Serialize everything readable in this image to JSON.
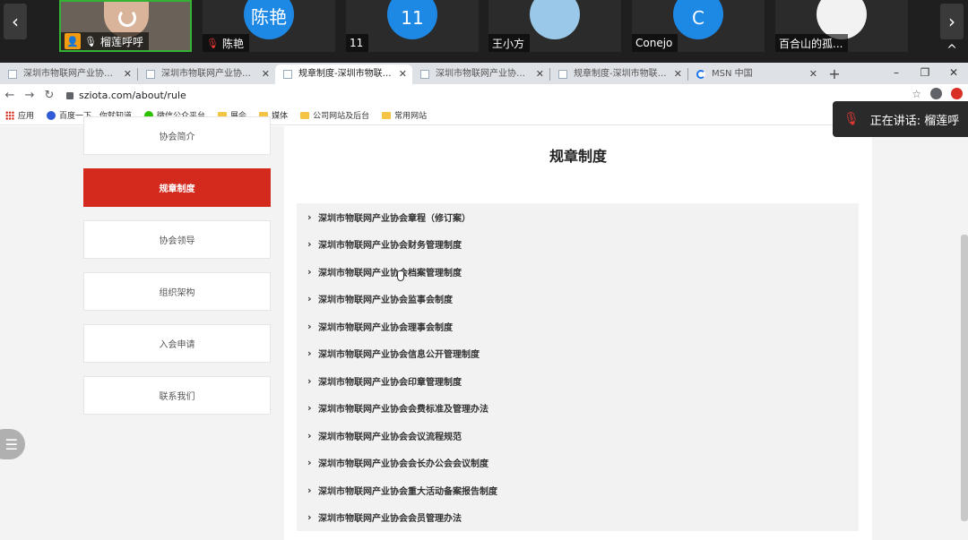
{
  "meeting": {
    "participants": [
      {
        "name": "榴莲呼呼",
        "avatar": ""
      },
      {
        "name": "陈艳",
        "avatar": "陈艳"
      },
      {
        "name": "11",
        "avatar": "11"
      },
      {
        "name": "王小方",
        "avatar": ""
      },
      {
        "name": "Conejo",
        "avatar": "C"
      },
      {
        "name": "百合山的孤...",
        "avatar": ""
      }
    ],
    "speaking": "正在讲话: 榴莲呼"
  },
  "browser": {
    "tabs": [
      {
        "title": "深圳市物联网产业协会-官方网站"
      },
      {
        "title": "深圳市物联网产业协会-官方网站"
      },
      {
        "title": "规章制度-深圳市物联网产业协会"
      },
      {
        "title": "深圳市物联网产业协会-官方网站"
      },
      {
        "title": "规章制度-深圳市物联网产业协会"
      },
      {
        "title": "MSN 中国"
      }
    ],
    "new_tab": "+",
    "url": "sziota.com/about/rule",
    "bookmarks": [
      "应用",
      "百度一下，你就知道",
      "微信公众平台",
      "展会",
      "媒体",
      "公司网站及后台",
      "常用网站"
    ]
  },
  "sidebar": {
    "items": [
      {
        "label": "协会简介"
      },
      {
        "label": "规章制度"
      },
      {
        "label": "协会领导"
      },
      {
        "label": "组织架构"
      },
      {
        "label": "入会申请"
      },
      {
        "label": "联系我们"
      }
    ]
  },
  "content": {
    "title": "规章制度",
    "rules": [
      "深圳市物联网产业协会章程（修订案）",
      "深圳市物联网产业协会财务管理制度",
      "深圳市物联网产业协会档案管理制度",
      "深圳市物联网产业协会监事会制度",
      "深圳市物联网产业协会理事会制度",
      "深圳市物联网产业协会信息公开管理制度",
      "深圳市物联网产业协会印章管理制度",
      "深圳市物联网产业协会会费标准及管理办法",
      "深圳市物联网产业协会会议流程规范",
      "深圳市物联网产业协会会长办公会会议制度",
      "深圳市物联网产业协会重大活动备案报告制度",
      "深圳市物联网产业协会会员管理办法"
    ]
  }
}
